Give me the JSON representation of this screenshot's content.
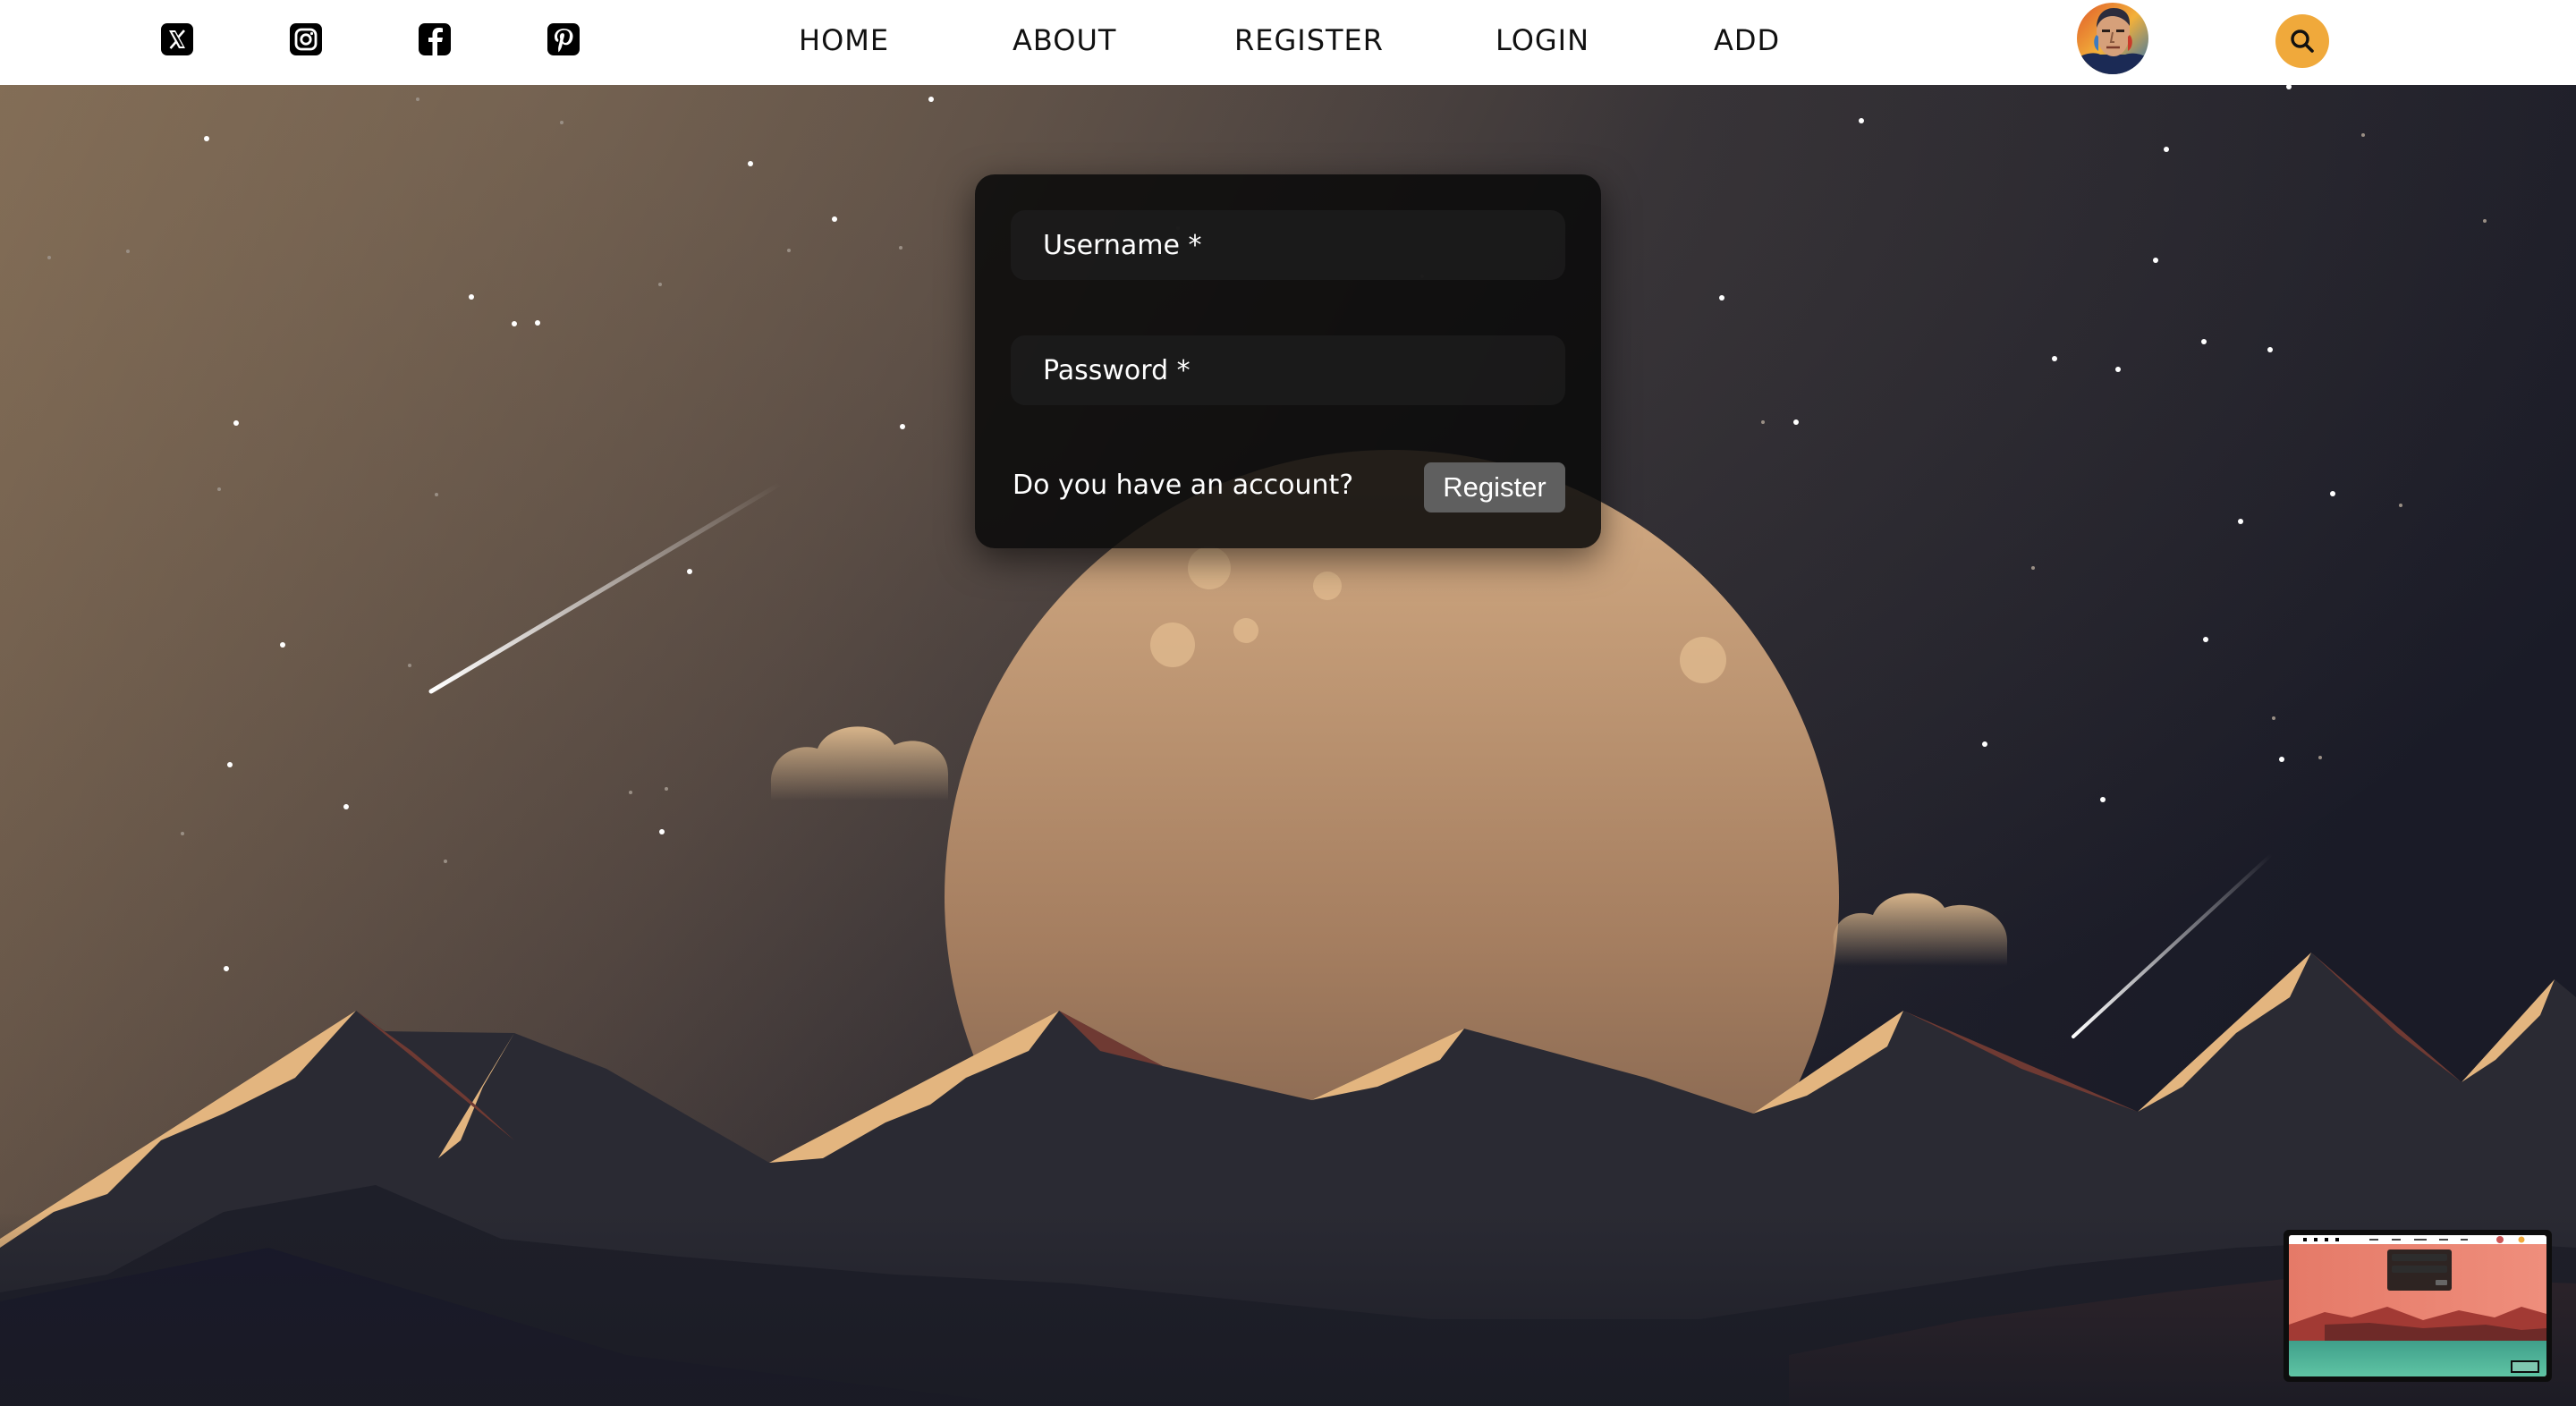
{
  "header": {
    "social": [
      {
        "name": "x-icon",
        "label": "X"
      },
      {
        "name": "instagram-icon",
        "label": "Instagram"
      },
      {
        "name": "facebook-icon",
        "label": "Facebook"
      },
      {
        "name": "pinterest-icon",
        "label": "Pinterest"
      }
    ],
    "nav": [
      {
        "label": "HOME"
      },
      {
        "label": "ABOUT"
      },
      {
        "label": "REGISTER"
      },
      {
        "label": "LOGIN"
      },
      {
        "label": "ADD"
      }
    ],
    "avatar_icon": "user-avatar",
    "search_icon": "search-icon",
    "accent_color": "#f0a93b"
  },
  "login_form": {
    "username_placeholder": "Username *",
    "password_placeholder": "Password *",
    "account_question": "Do you have an account?",
    "register_button": "Register"
  },
  "colors": {
    "sky_left": "#7a6550",
    "sky_right": "#1b1c28",
    "moon": "#c9a07a",
    "peak_highlight": "#e3b57f",
    "mountain": "#25252e"
  }
}
